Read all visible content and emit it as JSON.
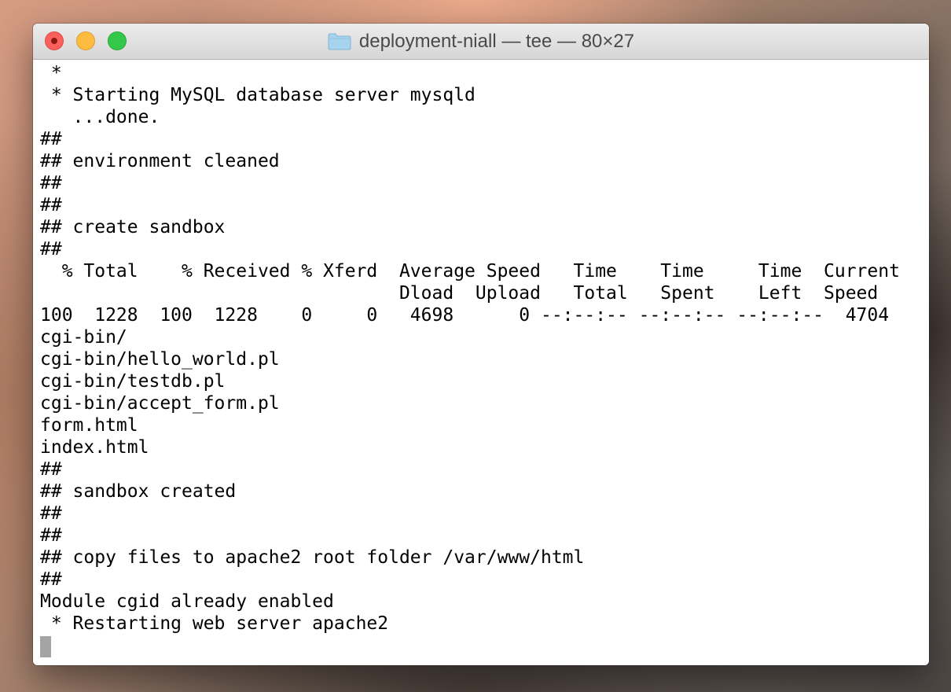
{
  "window": {
    "title": "deployment-niall — tee — 80×27",
    "title_icon": "folder-icon",
    "controls": [
      "close",
      "minimize",
      "zoom"
    ]
  },
  "terminal": {
    "lines": [
      " *",
      " * Starting MySQL database server mysqld",
      "   ...done.",
      "##",
      "## environment cleaned",
      "##",
      "##",
      "## create sandbox",
      "##",
      "  % Total    % Received % Xferd  Average Speed   Time    Time     Time  Current",
      "                                 Dload  Upload   Total   Spent    Left  Speed",
      "100  1228  100  1228    0     0   4698      0 --:--:-- --:--:-- --:--:--  4704",
      "cgi-bin/",
      "cgi-bin/hello_world.pl",
      "cgi-bin/testdb.pl",
      "cgi-bin/accept_form.pl",
      "form.html",
      "index.html",
      "##",
      "## sandbox created",
      "##",
      "##",
      "## copy files to apache2 root folder /var/www/html",
      "##",
      "Module cgid already enabled",
      " * Restarting web server apache2"
    ]
  },
  "colors": {
    "close": "#fc605b",
    "minimize": "#fdbc40",
    "zoom": "#34c84a",
    "cursor": "#a4a4a4",
    "folder": "#a8d3ef"
  }
}
